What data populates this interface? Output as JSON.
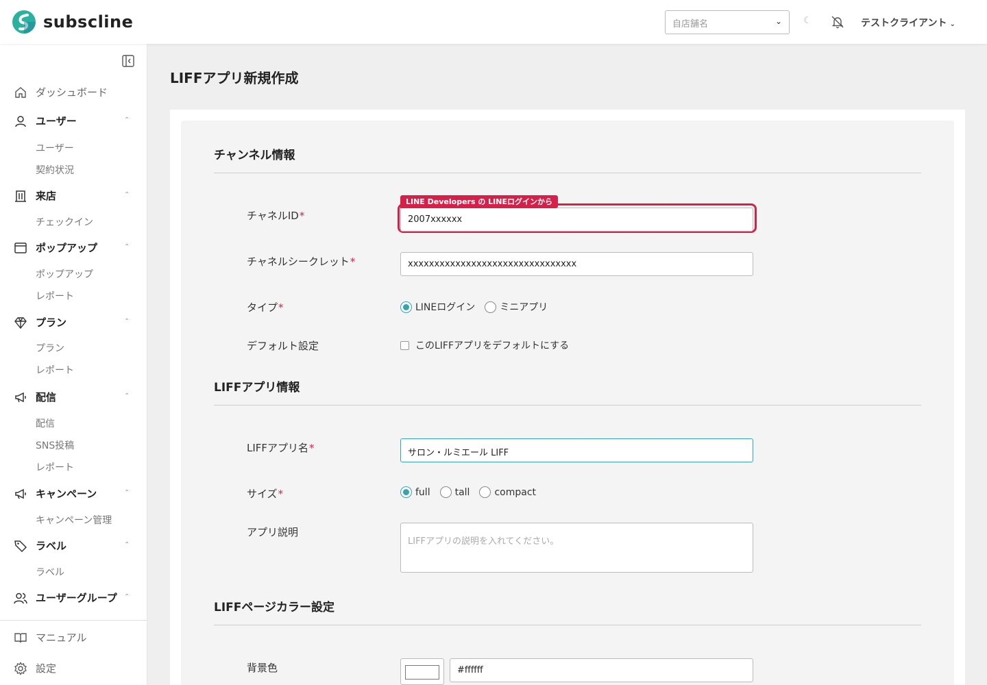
{
  "brand": {
    "name": "subscline"
  },
  "header": {
    "store_placeholder": "自店舗名",
    "user_name": "テストクライアント"
  },
  "sidebar": {
    "dashboard": "ダッシュボード",
    "users": {
      "label": "ユーザー",
      "items": [
        "ユーザー",
        "契約状況"
      ]
    },
    "visits": {
      "label": "来店",
      "items": [
        "チェックイン"
      ]
    },
    "popups": {
      "label": "ポップアップ",
      "items": [
        "ポップアップ",
        "レポート"
      ]
    },
    "plans": {
      "label": "プラン",
      "items": [
        "プラン",
        "レポート"
      ]
    },
    "delivery": {
      "label": "配信",
      "items": [
        "配信",
        "SNS投稿",
        "レポート"
      ]
    },
    "campaigns": {
      "label": "キャンペーン",
      "items": [
        "キャンペーン管理"
      ]
    },
    "labels": {
      "label": "ラベル",
      "items": [
        "ラベル"
      ]
    },
    "user_groups": {
      "label": "ユーザーグループ"
    },
    "manual": "マニュアル",
    "settings": "設定"
  },
  "page": {
    "title": "LIFFアプリ新規作成"
  },
  "channel_section": {
    "title": "チャンネル情報",
    "channel_id": {
      "label": "チャネルID",
      "required": "*",
      "value": "2007xxxxxx",
      "hint": "LINE Developers の LINEログインから"
    },
    "channel_secret": {
      "label": "チャネルシークレット",
      "required": "*",
      "value": "xxxxxxxxxxxxxxxxxxxxxxxxxxxxxxxx"
    },
    "type": {
      "label": "タイプ",
      "required": "*",
      "options": [
        "LINEログイン",
        "ミニアプリ"
      ],
      "selected": "LINEログイン"
    },
    "default": {
      "label": "デフォルト設定",
      "checkbox_label": "このLIFFアプリをデフォルトにする",
      "checked": false
    }
  },
  "liff_section": {
    "title": "LIFFアプリ情報",
    "name": {
      "label": "LIFFアプリ名",
      "required": "*",
      "value": "サロン・ルミエール LIFF"
    },
    "size": {
      "label": "サイズ",
      "required": "*",
      "options": [
        "full",
        "tall",
        "compact"
      ],
      "selected": "full"
    },
    "description": {
      "label": "アプリ説明",
      "placeholder": "LIFFアプリの説明を入れてください。"
    }
  },
  "color_section": {
    "title": "LIFFページカラー設定",
    "background": {
      "label": "背景色",
      "value": "#ffffff"
    }
  },
  "colors": {
    "accent": "#36a3b0",
    "required": "#d6204a",
    "logo_teal": "#2ab1a0"
  }
}
